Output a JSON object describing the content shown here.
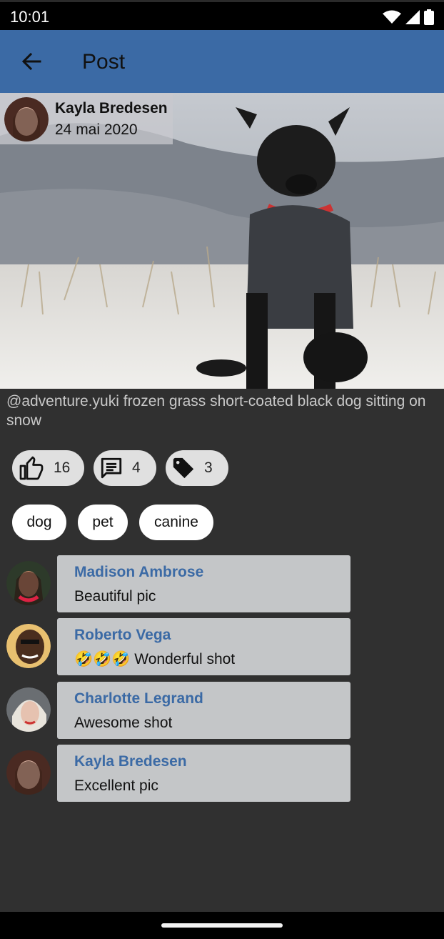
{
  "status_bar": {
    "time": "10:01"
  },
  "app_bar": {
    "title": "Post"
  },
  "post": {
    "author": "Kayla Bredesen",
    "date": "24 mai 2020",
    "caption": "@adventure.yuki frozen grass short-coated black dog sitting on snow"
  },
  "stats": [
    {
      "icon": "thumb-up-icon",
      "count": "16"
    },
    {
      "icon": "comment-icon",
      "count": "4"
    },
    {
      "icon": "tag-icon",
      "count": "3"
    }
  ],
  "tags": [
    "dog",
    "pet",
    "canine"
  ],
  "comments": [
    {
      "author": "Madison Ambrose",
      "text": "Beautiful pic"
    },
    {
      "author": "Roberto Vega",
      "text": "🤣🤣🤣 Wonderful shot"
    },
    {
      "author": "Charlotte Legrand",
      "text": "Awesome shot"
    },
    {
      "author": "Kayla Bredesen",
      "text": "Excellent pic"
    }
  ],
  "colors": {
    "app_bar": "#3b6aa5",
    "background": "#303030",
    "comment_author": "#3b6aa5",
    "comment_card": "#c4c6c8"
  }
}
